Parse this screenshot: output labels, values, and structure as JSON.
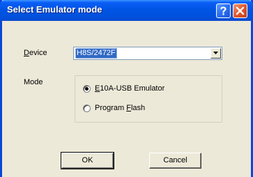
{
  "window": {
    "title": "Select Emulator mode"
  },
  "title_buttons": {
    "help_glyph": "?",
    "close_glyph": "X"
  },
  "device": {
    "label_accel": "D",
    "label_rest": "evice",
    "value": "H8S/2472F"
  },
  "mode": {
    "label": "Mode",
    "options": [
      {
        "accel": "E",
        "rest": "10A-USB Emulator",
        "selected": true
      },
      {
        "pre": "Program ",
        "accel": "F",
        "rest": "lash",
        "selected": false
      }
    ]
  },
  "buttons": {
    "ok": "OK",
    "cancel": "Cancel"
  },
  "colors": {
    "title_bar": "#0054e3",
    "dialog_bg": "#ece9d8",
    "selection": "#316ac5"
  }
}
